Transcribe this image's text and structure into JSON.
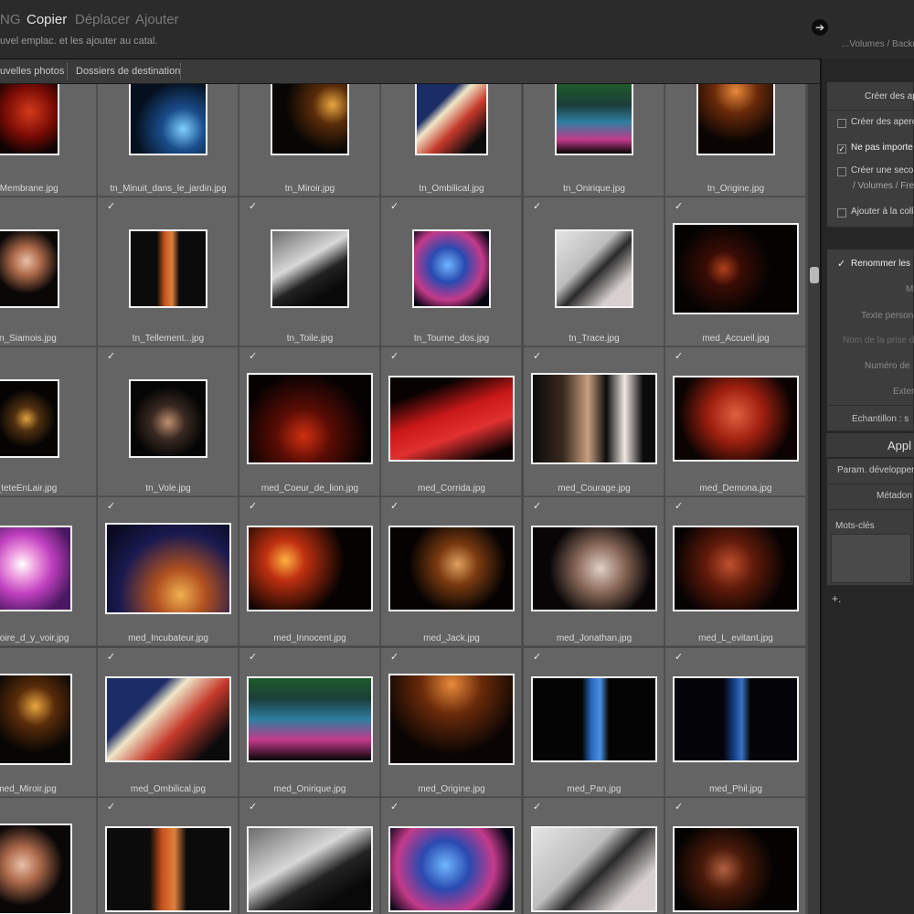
{
  "topbar": {
    "modes": [
      {
        "label": "NG",
        "active": false
      },
      {
        "label": "Copier",
        "active": true
      },
      {
        "label": "Déplacer",
        "active": false
      },
      {
        "label": "Ajouter",
        "active": false
      }
    ],
    "subtitle": "uvel emplac. et les ajouter au catal.",
    "round_button_icon": "➔",
    "destination_path": "...Volumes / Backup"
  },
  "tabs": [
    "uvelles photos",
    "Dossiers de destination"
  ],
  "grid": {
    "rows": [
      [
        {
          "name": "_Membrane.jpg",
          "checked": false,
          "tw": 72,
          "th": 80,
          "bg": "radial-gradient(circle at 55% 40%, #d43a1a 0%, #7a0c05 45%, #100303 80%)"
        },
        {
          "name": "tn_Minuit_dans_le_jardin.jpg",
          "checked": false,
          "tw": 86,
          "th": 80,
          "bg": "radial-gradient(circle at 70% 65%, #7fd0ff 0%, #1a4d8c 30%, #05101e 70%)"
        },
        {
          "name": "tn_Miroir.jpg",
          "checked": false,
          "tw": 86,
          "th": 80,
          "bg": "radial-gradient(circle at 80% 30%, #e8a640 0%, #5a2c0a 25%, #080604 60%)"
        },
        {
          "name": "tn_Ombilical.jpg",
          "checked": false,
          "tw": 80,
          "th": 80,
          "bg": "linear-gradient(135deg, #1b2c66 0%, #1b2c66 30%, #f0e6c8 40%, #c4392a 60%, #0b0b0b 85%)"
        },
        {
          "name": "tn_Onirique.jpg",
          "checked": false,
          "tw": 86,
          "th": 80,
          "bg": "linear-gradient(180deg, #1f5b2a 0%, #1b3d3a 30%, #2f7ea0 55%, #c23a8a 80%, #050505 100%)"
        },
        {
          "name": "tn_Origine.jpg",
          "checked": false,
          "tw": 86,
          "th": 80,
          "bg": "radial-gradient(circle at 50% 10%, #e88a3a 0%, #6a2a0a 30%, #0a0503 70%)"
        }
      ],
      [
        {
          "name": "tn_Siamois.jpg",
          "checked": false,
          "tw": 72,
          "th": 86,
          "bg": "radial-gradient(circle at 50% 40%, #e8c0a8 0%, #b06c4c 25%, #0a0707 60%)"
        },
        {
          "name": "tn_Tellement...jpg",
          "checked": true,
          "tw": 86,
          "th": 86,
          "bg": "linear-gradient(90deg, #0b0b0b 0%, #0b0b0b 35%, #c4521e 45%, #e0803c 55%, #0b0b0b 65%)"
        },
        {
          "name": "tn_Toile.jpg",
          "checked": true,
          "tw": 86,
          "th": 86,
          "bg": "linear-gradient(150deg, #6c6c6c 0%, #d8d8d8 40%, #222 60%, #090909 80%)"
        },
        {
          "name": "tn_Tourne_dos.jpg",
          "checked": true,
          "tw": 86,
          "th": 86,
          "bg": "radial-gradient(circle at 45% 45%, #6fb7ff 0%, #2a4ab0 30%, #c43a8a 60%, #050512 85%)"
        },
        {
          "name": "tn_Trace.jpg",
          "checked": true,
          "tw": 86,
          "th": 86,
          "bg": "linear-gradient(135deg, #e4e4e4 0%, #bdbdbd 40%, #2a2a2a 55%, #d8d0d0 80%)"
        },
        {
          "name": "med_Accueil.jpg",
          "checked": true,
          "tw": 138,
          "th": 100,
          "bg": "radial-gradient(circle at 40% 50%, #b0401a 0%, #3a0c05 20%, #040302 55%)"
        }
      ],
      [
        {
          "name": "_teteEnLair.jpg",
          "checked": false,
          "tw": 72,
          "th": 86,
          "bg": "radial-gradient(circle at 50% 50%, #e0a040 0%, #503010 25%, #050403 60%)"
        },
        {
          "name": "tn_Vole.jpg",
          "checked": true,
          "tw": 86,
          "th": 86,
          "bg": "radial-gradient(circle at 50% 55%, #c09070 0%, #3a2a22 30%, #050505 65%)"
        },
        {
          "name": "med_Coeur_de_lion.jpg",
          "checked": true,
          "tw": 138,
          "th": 100,
          "bg": "radial-gradient(circle at 45% 70%, #d03010 0%, #5a0c05 30%, #070202 70%)"
        },
        {
          "name": "med_Corrida.jpg",
          "checked": true,
          "tw": 138,
          "th": 94,
          "bg": "linear-gradient(160deg, #080202 0%, #080202 20%, #c81818 45%, #e03030 65%, #0a0202 90%)"
        },
        {
          "name": "med_Courage.jpg",
          "checked": true,
          "tw": 138,
          "th": 100,
          "bg": "linear-gradient(90deg, #0b0b0b 0%, #3a2a20 25%, #c8a080 45%, #0b0b0b 60%, #f0e8e0 75%, #0b0b0b 90%)"
        },
        {
          "name": "med_Demona.jpg",
          "checked": true,
          "tw": 138,
          "th": 94,
          "bg": "radial-gradient(circle at 50% 45%, #e06040 0%, #a02010 35%, #0a0302 75%)"
        }
      ],
      [
        {
          "name": "Histoire_d_y_voir.jpg",
          "checked": false,
          "tw": 100,
          "th": 94,
          "bg": "radial-gradient(circle at 45% 45%, #ffffff 0%, #f0a0e0 20%, #c040c0 45%, #4a1860 80%)"
        },
        {
          "name": "med_Incubateur.jpg",
          "checked": true,
          "tw": 138,
          "th": 100,
          "bg": "radial-gradient(circle at 60% 80%, #f0b050 0%, #b05020 25%, #1a1a50 60%, #0a0a20 90%)"
        },
        {
          "name": "med_Innocent.jpg",
          "checked": true,
          "tw": 138,
          "th": 94,
          "bg": "radial-gradient(circle at 30% 40%, #ffb040 0%, #c03010 20%, #050201 60%)"
        },
        {
          "name": "med_Jack.jpg",
          "checked": true,
          "tw": 138,
          "th": 94,
          "bg": "radial-gradient(circle at 55% 45%, #e0a060 0%, #7a3a10 25%, #050302 60%)"
        },
        {
          "name": "med_Jonathan.jpg",
          "checked": true,
          "tw": 138,
          "th": 94,
          "bg": "radial-gradient(circle at 55% 50%, #e0d0c8 0%, #8a6a5a 30%, #070505 65%)"
        },
        {
          "name": "med_L_evitant.jpg",
          "checked": true,
          "tw": 138,
          "th": 94,
          "bg": "radial-gradient(circle at 45% 45%, #c05030 0%, #601a0a 30%, #050202 70%)"
        }
      ],
      [
        {
          "name": "med_Miroir.jpg",
          "checked": false,
          "tw": 100,
          "th": 100,
          "bg": "radial-gradient(circle at 60% 35%, #e8a640 0%, #5a2c0a 25%, #080604 60%)"
        },
        {
          "name": "med_Ombilical.jpg",
          "checked": true,
          "tw": 138,
          "th": 94,
          "bg": "linear-gradient(135deg, #1b2c66 0%, #1b2c66 30%, #f0e6c8 40%, #c4392a 60%, #0b0b0b 85%)"
        },
        {
          "name": "med_Onirique.jpg",
          "checked": true,
          "tw": 138,
          "th": 94,
          "bg": "linear-gradient(180deg, #1f5b2a 0%, #1b3d3a 25%, #2f7ea0 50%, #c23a8a 75%, #050505 100%)"
        },
        {
          "name": "med_Origine.jpg",
          "checked": true,
          "tw": 138,
          "th": 100,
          "bg": "radial-gradient(circle at 50% 10%, #e88a3a 0%, #6a2a0a 30%, #0a0503 70%)"
        },
        {
          "name": "med_Pan.jpg",
          "checked": true,
          "tw": 138,
          "th": 94,
          "bg": "linear-gradient(90deg, #040404 0%, #040404 40%, #2a6ac0 48%, #4a90e0 55%, #040404 62%)"
        },
        {
          "name": "med_Phil.jpg",
          "checked": true,
          "tw": 138,
          "th": 94,
          "bg": "linear-gradient(90deg, #030308 0%, #030308 40%, #1a4a9a 50%, #3a70c0 55%, #030308 62%)"
        }
      ],
      [
        {
          "name": "",
          "checked": false,
          "tw": 100,
          "th": 100,
          "bg": "radial-gradient(circle at 45% 45%, #e8c0a8 0%, #b06c4c 25%, #0a0707 60%)"
        },
        {
          "name": "",
          "checked": true,
          "tw": 138,
          "th": 94,
          "bg": "linear-gradient(90deg, #0b0b0b 0%, #0b0b0b 35%, #c4521e 45%, #e0803c 55%, #0b0b0b 65%)"
        },
        {
          "name": "",
          "checked": true,
          "tw": 138,
          "th": 94,
          "bg": "linear-gradient(150deg, #6c6c6c 0%, #d8d8d8 40%, #222 60%, #090909 80%)"
        },
        {
          "name": "",
          "checked": true,
          "tw": 138,
          "th": 94,
          "bg": "radial-gradient(circle at 45% 45%, #6fb7ff 0%, #2a4ab0 30%, #c43a8a 60%, #050512 85%)"
        },
        {
          "name": "",
          "checked": true,
          "tw": 138,
          "th": 94,
          "bg": "linear-gradient(135deg, #e4e4e4 0%, #bdbdbd 40%, #2a2a2a 55%, #d8d0d0 80%)"
        },
        {
          "name": "",
          "checked": true,
          "tw": 138,
          "th": 94,
          "bg": "radial-gradient(circle at 40% 50%, #b06040 0%, #4a1a0a 25%, #040302 60%)"
        }
      ]
    ]
  },
  "right_panel": {
    "preview_build": "Créer des ap",
    "options": [
      {
        "label": "Créer des aperç",
        "checked": false
      },
      {
        "label": "Ne pas importe",
        "checked": true
      },
      {
        "label": "Créer une secon",
        "checked": false
      },
      {
        "label": "Ajouter à la coll",
        "checked": false
      }
    ],
    "second_copy_path": "/ Volumes / Fre",
    "rename_label": "Renommer les",
    "rename_checked": true,
    "rename_fields": [
      "M",
      "Texte person",
      "Nom de la prise d",
      "Numéro de",
      "Exter"
    ],
    "sample": "Echantillon : s",
    "apply_header": "Appl",
    "apply_rows": [
      "Param. développer",
      "Métadon",
      "Mots-clés"
    ],
    "add_button": "+."
  },
  "scroll": {
    "position": 0.22
  }
}
